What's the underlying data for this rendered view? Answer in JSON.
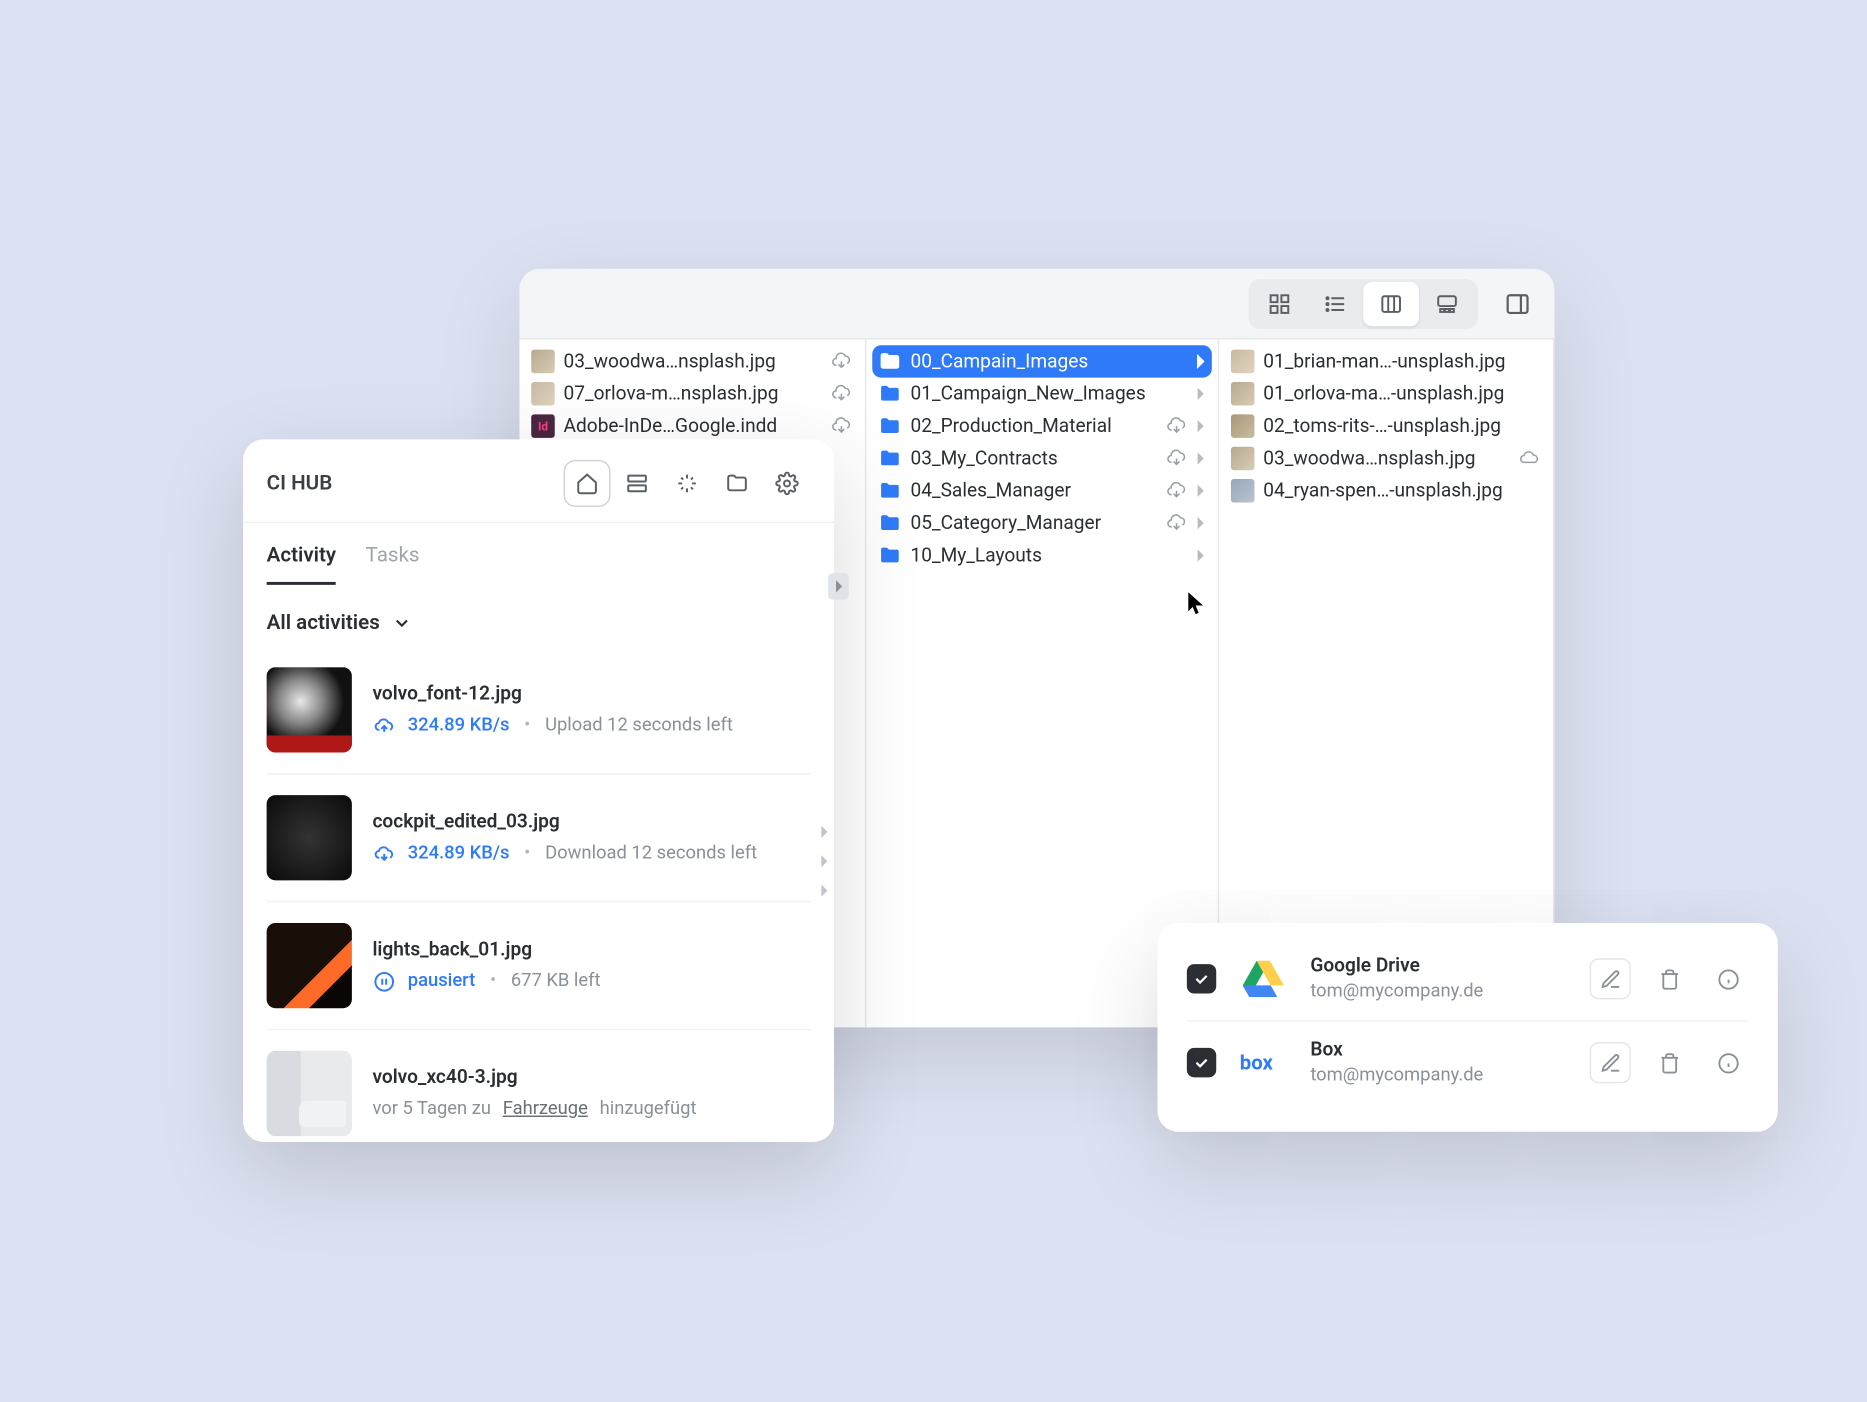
{
  "finder": {
    "col1": [
      {
        "label": "03_woodwa…nsplash.jpg"
      },
      {
        "label": "07_orlova-m…nsplash.jpg"
      },
      {
        "label": "Adobe-InDe…Google.indd"
      }
    ],
    "col2": [
      {
        "label": "00_Campain_Images",
        "selected": true
      },
      {
        "label": "01_Campaign_New_Images"
      },
      {
        "label": "02_Production_Material"
      },
      {
        "label": "03_My_Contracts"
      },
      {
        "label": "04_Sales_Manager"
      },
      {
        "label": "05_Category_Manager"
      },
      {
        "label": "10_My_Layouts"
      }
    ],
    "col3": [
      {
        "label": "01_brian-man…-unsplash.jpg"
      },
      {
        "label": "01_orlova-ma…-unsplash.jpg"
      },
      {
        "label": "02_toms-rits-…-unsplash.jpg"
      },
      {
        "label": "03_woodwa…nsplash.jpg"
      },
      {
        "label": "04_ryan-spen…-unsplash.jpg"
      }
    ]
  },
  "cihub": {
    "title": "CI HUB",
    "tabs": [
      "Activity",
      "Tasks"
    ],
    "filter": "All activities",
    "activities": [
      {
        "name": "volvo_font-12.jpg",
        "speed": "324.89 KB/s",
        "status": "Upload 12 seconds left"
      },
      {
        "name": "cockpit_edited_03.jpg",
        "speed": "324.89 KB/s",
        "status": "Download 12 seconds left"
      },
      {
        "name": "lights_back_01.jpg",
        "state": "pausiert",
        "remaining": "677 KB left"
      },
      {
        "name": "volvo_xc40-3.jpg",
        "prefix": "vor 5 Tagen zu",
        "link": "Fahrzeuge",
        "suffix": "hinzugefügt"
      }
    ]
  },
  "accounts": [
    {
      "name": "Google Drive",
      "email": "tom@mycompany.de"
    },
    {
      "name": "Box",
      "email": "tom@mycompany.de"
    }
  ]
}
